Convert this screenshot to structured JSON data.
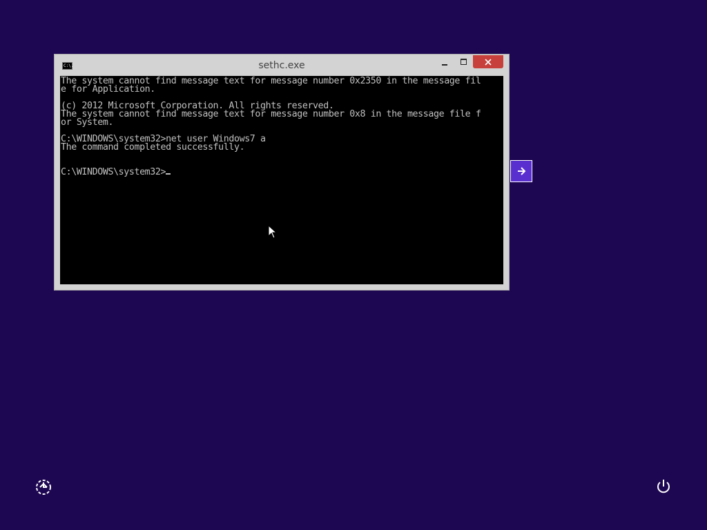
{
  "window": {
    "title": "sethc.exe",
    "icon_name": "cmd-icon",
    "icon_text": "C:\\.",
    "console_lines": [
      "The system cannot find message text for message number 0x2350 in the message fil",
      "e for Application.",
      "",
      "(c) 2012 Microsoft Corporation. All rights reserved.",
      "The system cannot find message text for message number 0x8 in the message file f",
      "or System.",
      "",
      "C:\\WINDOWS\\system32>net user Windows7 a",
      "The command completed successfully.",
      "",
      "",
      "C:\\WINDOWS\\system32>"
    ]
  },
  "controls": {
    "minimize_icon": "minimize-icon",
    "maximize_icon": "maximize-icon",
    "close_icon": "close-icon"
  },
  "desktop": {
    "background_color": "#1e0752",
    "next_icon": "arrow-right-icon",
    "ease_of_access_icon": "ease-of-access-icon",
    "power_icon": "power-icon",
    "close_color": "#c7403b",
    "next_color": "#5a2fd0"
  }
}
